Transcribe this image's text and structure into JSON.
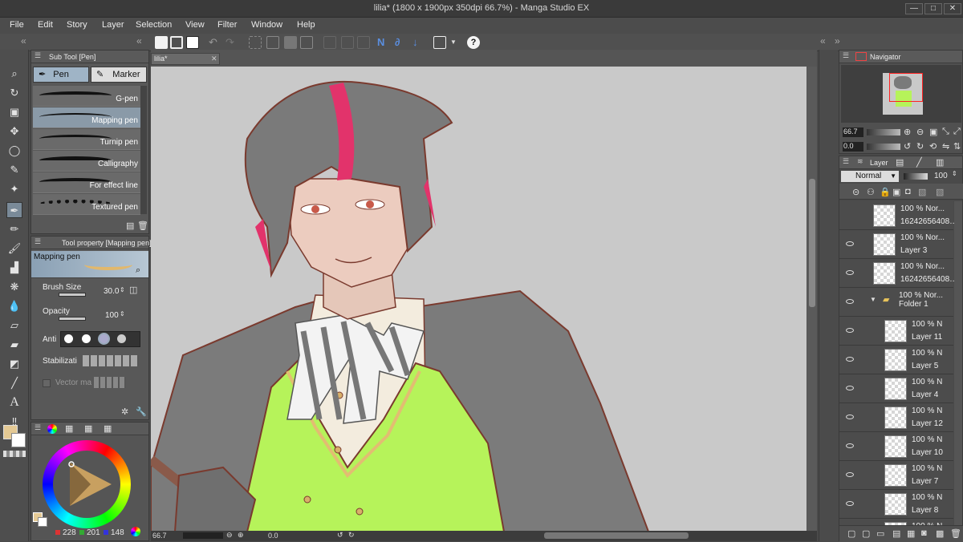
{
  "window": {
    "title": "lilia* (1800 x 1900px 350dpi 66.7%) - Manga Studio EX",
    "minimize": "—",
    "maximize": "□",
    "close": "✕"
  },
  "menu": [
    "File",
    "Edit",
    "Story",
    "Layer",
    "Selection",
    "View",
    "Filter",
    "Window",
    "Help"
  ],
  "subtool": {
    "header": "Sub Tool [Pen]",
    "tabs": [
      "Pen",
      "Marker"
    ],
    "brushes": [
      "G-pen",
      "Mapping pen",
      "Turnip pen",
      "Calligraphy",
      "For effect line",
      "Textured pen"
    ],
    "selected": "Mapping pen"
  },
  "toolprop": {
    "header": "Tool property [Mapping pen]",
    "brush_name": "Mapping pen",
    "brush_size_label": "Brush Size",
    "brush_size_value": "30.0",
    "opacity_label": "Opacity",
    "opacity_value": "100",
    "antialias_label": "Anti",
    "stabilization_label": "Stabilizati",
    "vector_label": "Vector ma"
  },
  "color": {
    "main_color": "#e4c994",
    "r": "228",
    "g": "201",
    "b": "148"
  },
  "document": {
    "tab": "lilia*",
    "zoom": "66.7",
    "rotation": "0.0"
  },
  "navigator": {
    "header": "Navigator",
    "zoom": "66.7",
    "rotation": "0.0"
  },
  "layers": {
    "header": "Layer",
    "blend_mode": "Normal",
    "opacity": "100",
    "rows": [
      {
        "l1": "100 %  Nor...",
        "l2": "16242656408…",
        "indent": false,
        "eye": false
      },
      {
        "l1": "100 %  Nor...",
        "l2": "Layer 3",
        "indent": false,
        "eye": true
      },
      {
        "l1": "100 %  Nor...",
        "l2": "16242656408…",
        "indent": false,
        "eye": true
      },
      {
        "l1": "100 %  Nor...",
        "l2": "Folder 1",
        "indent": false,
        "eye": true,
        "folder": true
      },
      {
        "l1": "100 %  N",
        "l2": "Layer 11",
        "indent": true,
        "eye": true
      },
      {
        "l1": "100 %  N",
        "l2": "Layer 5",
        "indent": true,
        "eye": true
      },
      {
        "l1": "100 %  N",
        "l2": "Layer 4",
        "indent": true,
        "eye": true
      },
      {
        "l1": "100 %  N",
        "l2": "Layer 12",
        "indent": true,
        "eye": true
      },
      {
        "l1": "100 %  N",
        "l2": "Layer 10",
        "indent": true,
        "eye": true
      },
      {
        "l1": "100 %  N",
        "l2": "Layer 7",
        "indent": true,
        "eye": true
      },
      {
        "l1": "100 %  N",
        "l2": "Layer 8",
        "indent": true,
        "eye": true
      },
      {
        "l1": "100 %  N",
        "l2": "",
        "indent": true,
        "eye": true
      }
    ]
  }
}
